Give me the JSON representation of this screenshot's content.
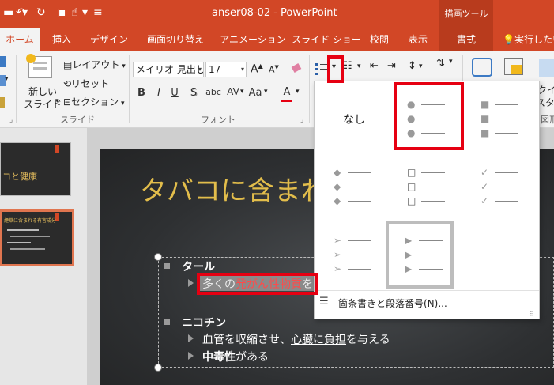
{
  "titlebar": {
    "title": "anser08-02 - PowerPoint",
    "context_label": "描画ツール"
  },
  "tabs": [
    {
      "label": "ホーム"
    },
    {
      "label": "挿入"
    },
    {
      "label": "デザイン"
    },
    {
      "label": "画面切り替え"
    },
    {
      "label": "アニメーション"
    },
    {
      "label": "スライド ショー"
    },
    {
      "label": "校閲"
    },
    {
      "label": "表示"
    },
    {
      "label": "書式"
    },
    {
      "label": "実行したい"
    }
  ],
  "ribbon": {
    "new_slide_line1": "新しい",
    "new_slide_line2": "スライド",
    "layout": "レイアウト",
    "reset": "リセット",
    "section": "セクション",
    "slides_group": "スライド",
    "font_name": "メイリオ 見出し",
    "font_size": "17",
    "font_group": "フォント",
    "font_btn_b": "B",
    "font_btn_i": "I",
    "font_btn_u": "U",
    "font_btn_s": "S",
    "font_btn_abc": "abc",
    "font_btn_av": "AV",
    "font_btn_aa": "Aa",
    "font_btn_a": "A",
    "grow_font": "A",
    "shrink_font": "A",
    "right_cut": "クイ",
    "right_cut2": "スタイ",
    "right_cut3": "図形"
  },
  "thumbnails": [
    {
      "text": "コと健康"
    },
    {
      "text": "煙草に含まれる有害成分"
    }
  ],
  "slide": {
    "title": "タバコに含まれ",
    "bullet1": "タール",
    "sub1_prefix": "多くの",
    "sub1_red": "発がん性物質",
    "sub1_suffix": "を",
    "bullet2": "ニコチン",
    "sub2_a": "血管を収縮させ、",
    "sub2_b": "心臓に負担",
    "sub2_c": "を与える",
    "sub3_a": "中毒性",
    "sub3_b": "がある"
  },
  "gallery": {
    "none_label": "なし",
    "footer_label": "箇条書きと段落番号(N)...",
    "options": [
      "なし",
      "filled-circle",
      "filled-square",
      "diamond",
      "hollow-square",
      "checkmark",
      "arrowhead",
      "triangle"
    ]
  },
  "colors": {
    "accent": "#d24726",
    "title_yellow": "#e2bd4b",
    "highlight_red": "#e60012"
  }
}
